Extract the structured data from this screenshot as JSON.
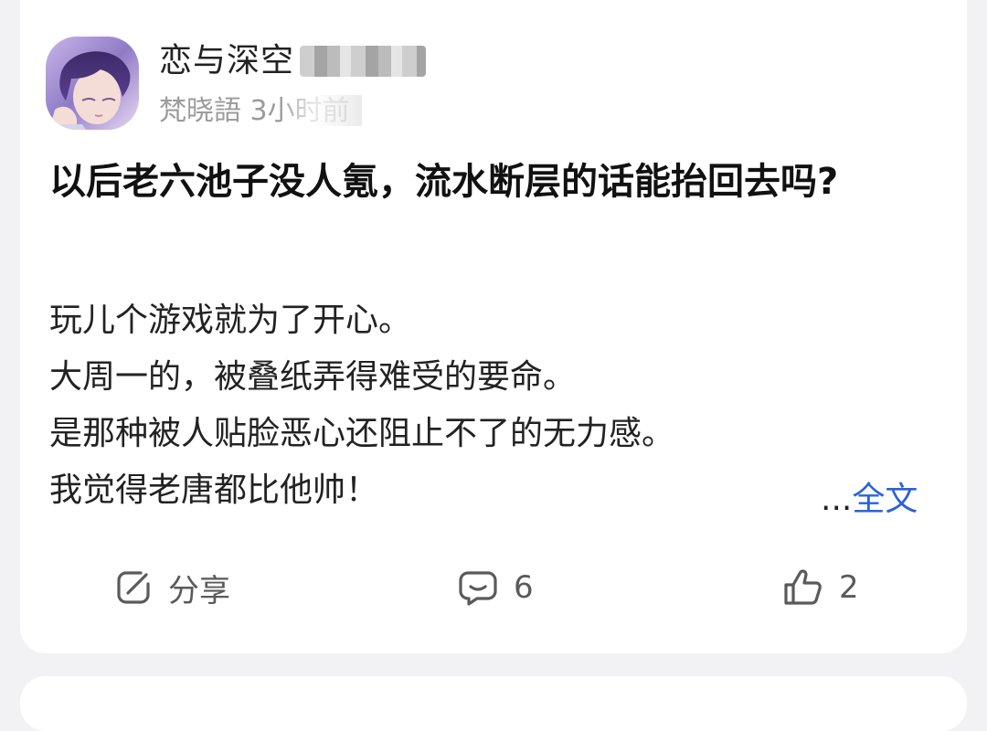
{
  "post": {
    "author": {
      "name": "恋与深空",
      "avatar": "character-avatar"
    },
    "meta": {
      "source": "梵晓語",
      "time": "3小时前"
    },
    "title": "以后老六池子没人氪，流水断层的话能抬回去吗?",
    "body_lines": [
      "玩儿个游戏就为了开心。",
      "大周一的，被叠纸弄得难受的要命。",
      "是那种被人贴脸恶心还阻止不了的无力感。",
      "我觉得老唐都比他帅！"
    ],
    "more": {
      "ellipsis": "...",
      "label": "全文"
    },
    "actions": {
      "share_label": "分享",
      "comment_count": "6",
      "like_count": "2"
    }
  },
  "colors": {
    "link": "#2c62d6",
    "muted": "#9b9b9b",
    "background": "#f2f2f4"
  },
  "icons": [
    "share-icon",
    "comment-icon",
    "thumbs-up-icon"
  ]
}
